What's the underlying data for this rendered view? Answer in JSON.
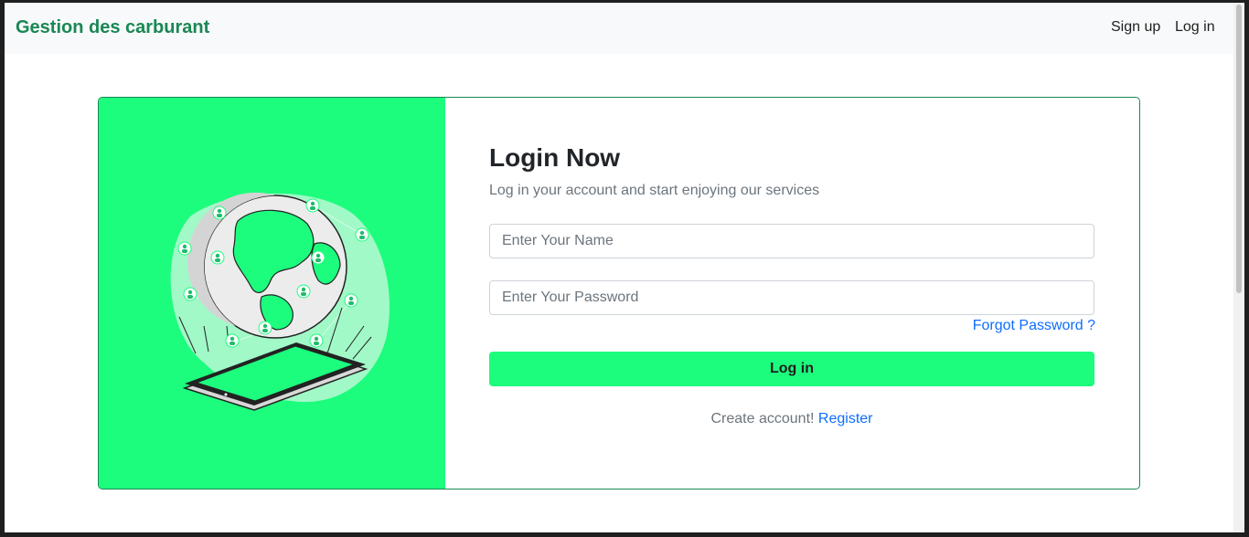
{
  "navbar": {
    "brand": "Gestion des carburant",
    "links": {
      "signup": "Sign up",
      "login": "Log in"
    }
  },
  "login_card": {
    "title": "Login Now",
    "subtitle": "Log in your account and start enjoying our services",
    "name_placeholder": "Enter Your Name",
    "name_value": "",
    "password_placeholder": "Enter Your Password",
    "password_value": "",
    "forgot_password": "Forgot Password ?",
    "login_button": "Log in",
    "create_account_text": "Create account!",
    "register_link": "Register"
  },
  "colors": {
    "brand": "#198754",
    "accent_green": "#1dfd7d",
    "link_blue": "#0d6efd",
    "muted_text": "#6c757d"
  },
  "icons": {
    "illustration": "globe-network-tablet-illustration"
  }
}
